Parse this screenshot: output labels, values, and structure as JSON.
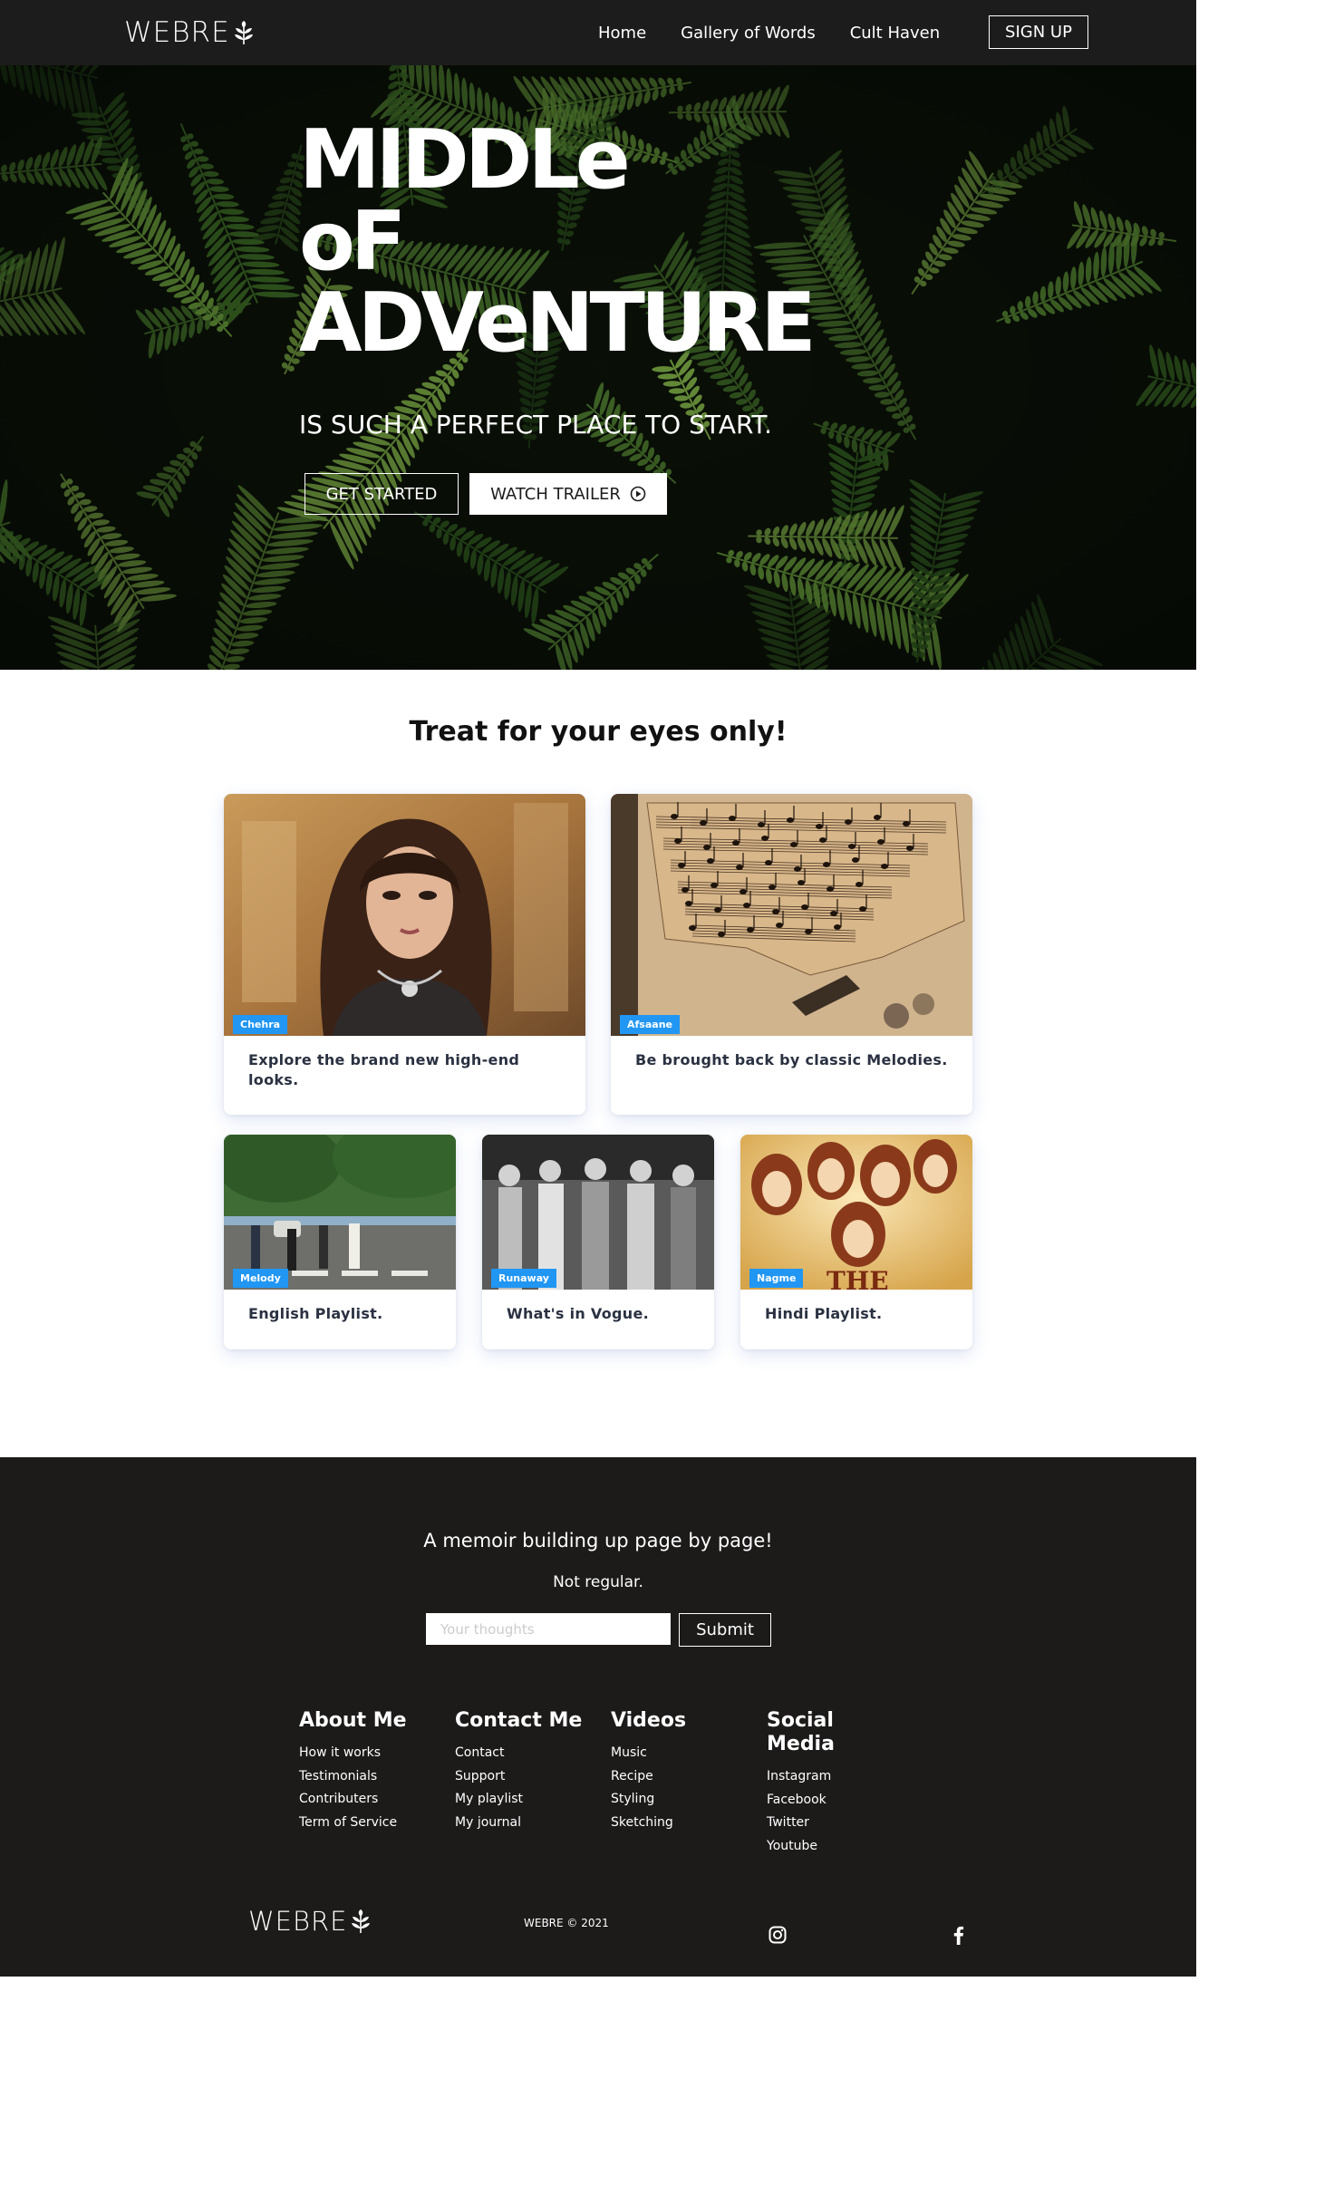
{
  "brand": {
    "logo_text": "WEBRE"
  },
  "nav": {
    "links": [
      "Home",
      "Gallery of Words",
      "Cult Haven"
    ],
    "signup_label": "SIGN UP"
  },
  "hero": {
    "title_lines": [
      "MIDDLe",
      "oF",
      "ADVeNTURE"
    ],
    "subtitle": "IS SUCH A PERFECT PLACE TO START.",
    "get_started_label": "GET STARTED",
    "watch_trailer_label": "WATCH TRAILER"
  },
  "gallery": {
    "title": "Treat for your eyes only!",
    "cards": [
      {
        "tag": "Chehra",
        "text": "Explore the brand new high-end looks."
      },
      {
        "tag": "Afsaane",
        "text": "Be brought back by classic Melodies."
      },
      {
        "tag": "Melody",
        "text": "English Playlist."
      },
      {
        "tag": "Runaway",
        "text": "What's in Vogue."
      },
      {
        "tag": "Nagme",
        "text": "Hindi Playlist."
      }
    ]
  },
  "footer": {
    "memoir": "A memoir building up page by page!",
    "not_regular": "Not regular.",
    "input_placeholder": "Your thoughts",
    "submit_label": "Submit",
    "columns": [
      {
        "title": "About Me",
        "links": [
          "How it works",
          "Testimonials",
          "Contributers",
          "Term of Service"
        ]
      },
      {
        "title": "Contact Me",
        "links": [
          "Contact",
          "Support",
          "My playlist",
          "My journal"
        ]
      },
      {
        "title": "Videos",
        "links": [
          "Music",
          "Recipe",
          "Styling",
          "Sketching"
        ]
      },
      {
        "title": "Social Media",
        "links": [
          "Instagram",
          "Facebook",
          "Twitter",
          "Youtube"
        ]
      }
    ],
    "logo_text": "WEBRE",
    "copyright": "WEBRE © 2021",
    "social_icons": [
      "instagram-icon",
      "facebook-icon"
    ]
  },
  "colors": {
    "nav_bg": "#1c1c1c",
    "footer_bg": "#1c1b1a",
    "tag_blue": "#2196f3",
    "card_text": "#2a3141"
  }
}
